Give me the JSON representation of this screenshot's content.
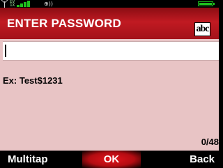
{
  "status_bar": {
    "network_text": "EV\n1X",
    "roaming_glyph": "⊕))",
    "signal_color": "#1ec21e"
  },
  "title_bar": {
    "title": "ENTER PASSWORD",
    "input_mode": "abc",
    "bg_color": "#b3141c"
  },
  "password_input": {
    "value": ""
  },
  "hint_text": "Ex: Test$1231",
  "char_counter": "0/48",
  "softkeys": {
    "left": "Multitap",
    "center": "OK",
    "right": "Back"
  },
  "colors": {
    "body_bg": "#e8c4c5",
    "accent": "#e3141c"
  }
}
